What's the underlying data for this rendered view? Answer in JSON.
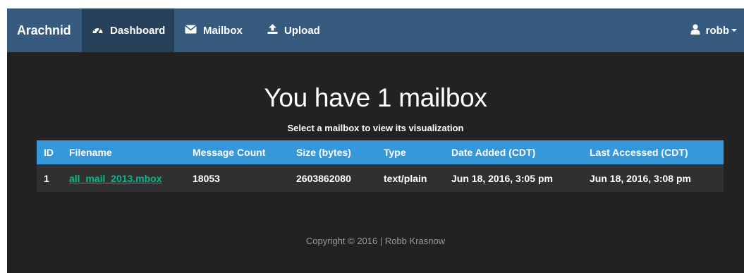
{
  "navbar": {
    "brand": "Arachnid",
    "items": [
      {
        "label": "Dashboard",
        "icon": "dashboard-icon",
        "active": true
      },
      {
        "label": "Mailbox",
        "icon": "envelope-icon",
        "active": false
      },
      {
        "label": "Upload",
        "icon": "upload-icon",
        "active": false
      }
    ],
    "user": {
      "label": "robb",
      "icon": "user-icon"
    }
  },
  "main": {
    "title": "You have 1 mailbox",
    "subtitle": "Select a mailbox to view its visualization",
    "table": {
      "headers": [
        "ID",
        "Filename",
        "Message Count",
        "Size (bytes)",
        "Type",
        "Date Added (CDT)",
        "Last Accessed (CDT)"
      ],
      "rows": [
        {
          "id": "1",
          "filename": "all_mail_2013.mbox",
          "message_count": "18053",
          "size": "2603862080",
          "type": "text/plain",
          "date_added": "Jun 18, 2016, 3:05 pm",
          "last_accessed": "Jun 18, 2016, 3:08 pm"
        }
      ]
    }
  },
  "footer": {
    "text": "Copyright © 2016 | Robb Krasnow"
  },
  "colors": {
    "navbar": "#375a7f",
    "navbar_active": "#28415b",
    "page_background": "#222222",
    "table_header": "#3498db",
    "table_row": "#303030",
    "link": "#00bc8c",
    "footer_text": "#999999"
  }
}
